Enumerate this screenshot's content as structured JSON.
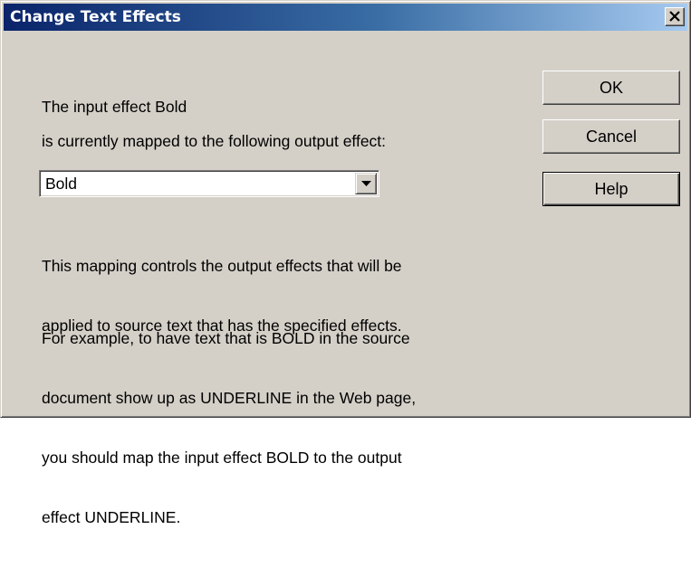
{
  "window": {
    "title": "Change Text Effects",
    "close_glyph": "✕",
    "title_gradient": [
      "#0a246a",
      "#a6caf0"
    ],
    "face_color": "#d4d0c8"
  },
  "content": {
    "input_effect_line": "The input effect   Bold",
    "mapped_line": "is currently mapped to the following output effect:",
    "output_effect": {
      "selected": "Bold",
      "arrow_icon": "dropdown-arrow-icon"
    },
    "description": [
      "This mapping controls the output effects that will be",
      "applied to source text that has the specified effects."
    ],
    "example": [
      "For example, to have text that is BOLD in the source",
      "document show up as UNDERLINE in the Web page,",
      "you should map the input effect BOLD to the output",
      "effect UNDERLINE."
    ]
  },
  "buttons": {
    "ok": "OK",
    "cancel": "Cancel",
    "help": "Help"
  }
}
